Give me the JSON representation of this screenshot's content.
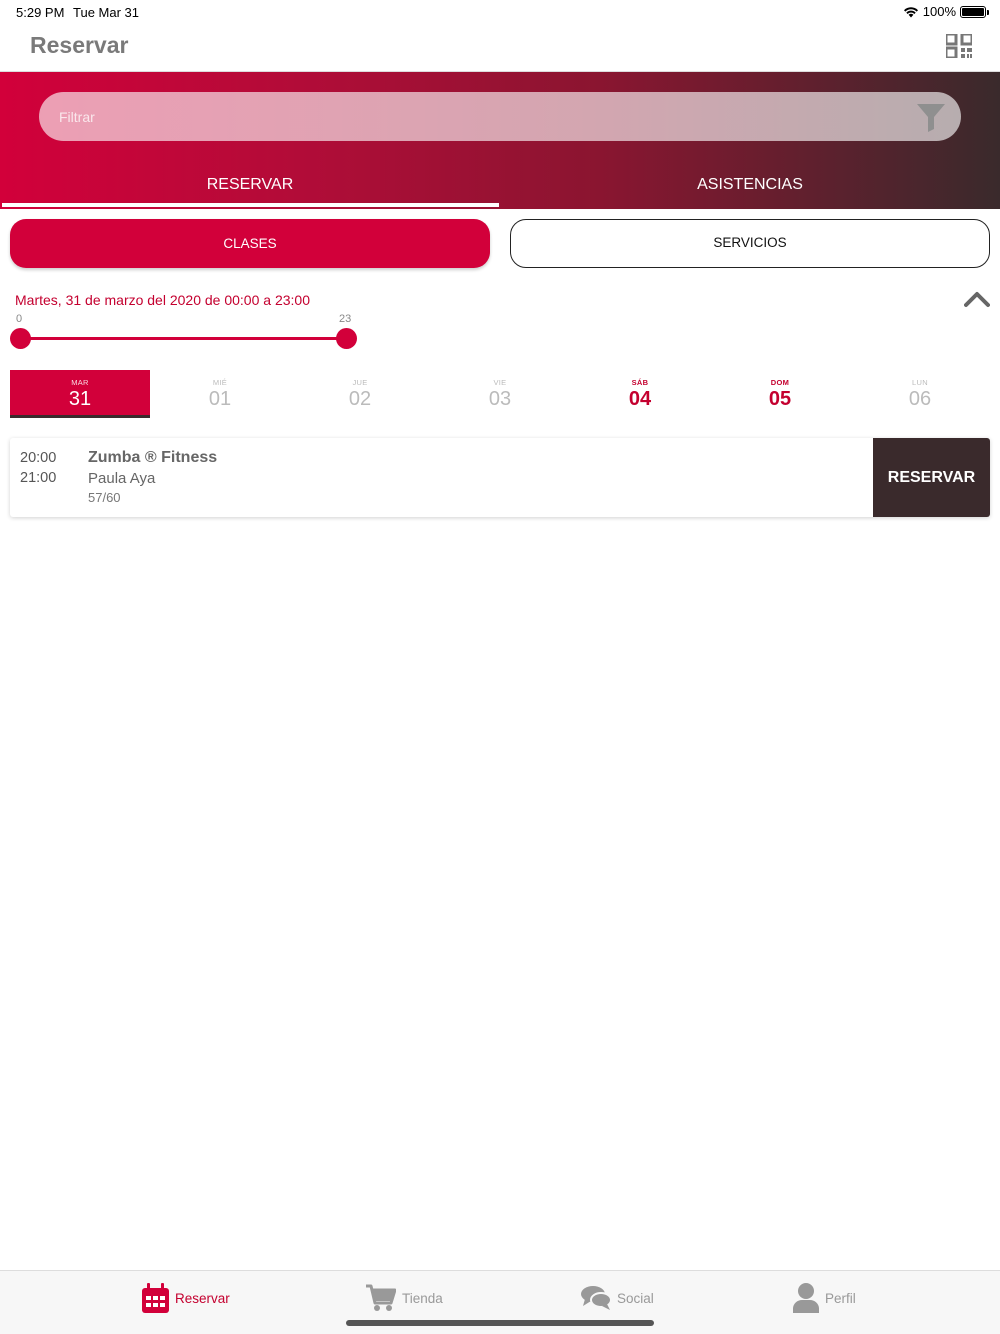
{
  "status": {
    "time": "5:29 PM",
    "date": "Tue Mar 31",
    "battery": "100%"
  },
  "nav": {
    "title": "Reservar",
    "qr_icon": "qr-code-icon"
  },
  "search": {
    "placeholder": "Filtrar",
    "value": ""
  },
  "top_tabs": [
    {
      "label": "RESERVAR",
      "active": true
    },
    {
      "label": "ASISTENCIAS",
      "active": false
    }
  ],
  "segments": {
    "clases": "CLASES",
    "servicios": "SERVICIOS",
    "selected": "CLASES"
  },
  "range": {
    "label": "Martes, 31 de marzo del 2020 de 00:00 a 23:00",
    "min_label": "0",
    "max_label": "23",
    "start": 0,
    "end": 23
  },
  "days": [
    {
      "name": "MAR",
      "num": "31",
      "selected": true,
      "weekend": false
    },
    {
      "name": "MIÉ",
      "num": "01",
      "selected": false,
      "weekend": false
    },
    {
      "name": "JUE",
      "num": "02",
      "selected": false,
      "weekend": false
    },
    {
      "name": "VIE",
      "num": "03",
      "selected": false,
      "weekend": false
    },
    {
      "name": "SÁB",
      "num": "04",
      "selected": false,
      "weekend": true
    },
    {
      "name": "DOM",
      "num": "05",
      "selected": false,
      "weekend": true
    },
    {
      "name": "LUN",
      "num": "06",
      "selected": false,
      "weekend": false
    }
  ],
  "classes": [
    {
      "start": "20:00",
      "end": "21:00",
      "title": "Zumba ® Fitness",
      "instructor": "Paula Aya",
      "capacity": "57/60",
      "button": "RESERVAR"
    }
  ],
  "tab_bar": [
    {
      "label": "Reservar",
      "icon": "calendar-icon",
      "active": true
    },
    {
      "label": "Tienda",
      "icon": "cart-icon",
      "active": false
    },
    {
      "label": "Social",
      "icon": "chat-bubbles-icon",
      "active": false
    },
    {
      "label": "Perfil",
      "icon": "user-icon",
      "active": false
    }
  ],
  "colors": {
    "primary": "#d2003a",
    "dark": "#3a2a2c",
    "accent_text": "#c4002f"
  }
}
